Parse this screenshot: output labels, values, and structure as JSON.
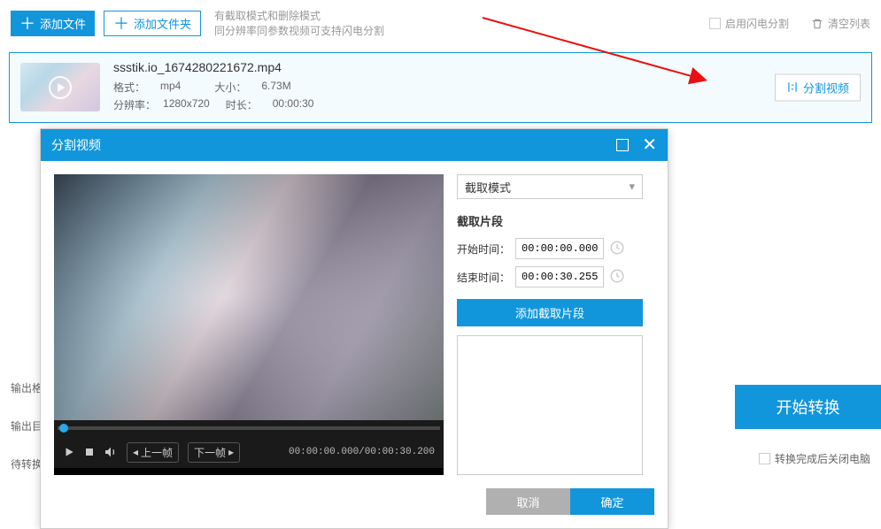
{
  "toolbar": {
    "add_file": "添加文件",
    "add_folder": "添加文件夹",
    "hint_line1": "有截取模式和删除模式",
    "hint_line2": "同分辨率同参数视频可支持闪电分割",
    "enable_flash": "启用闪电分割",
    "clear_list": "清空列表"
  },
  "file": {
    "name": "ssstik.io_1674280221672.mp4",
    "format_label": "格式：",
    "format": "mp4",
    "size_label": "大小：",
    "size": "6.73M",
    "res_label": "分辨率：",
    "res": "1280x720",
    "dur_label": "时长：",
    "dur": "00:00:30",
    "split_btn": "分割视频"
  },
  "dialog": {
    "title": "分割视频",
    "mode": "截取模式",
    "section_title": "截取片段",
    "start_label": "开始时间：",
    "start_value": "00:00:00.000",
    "end_label": "结束时间：",
    "end_value": "00:00:30.255",
    "add_segment": "添加截取片段",
    "cancel": "取消",
    "ok": "确定"
  },
  "player": {
    "prev_frame": "上一帧",
    "next_frame": "下一帧",
    "time": "00:00:00.000/00:00:30.200"
  },
  "bottom": {
    "out_format": "输出格",
    "out_dir": "输出目",
    "waiting": "待转换",
    "convert": "开始转换",
    "shutdown": "转换完成后关闭电脑"
  }
}
